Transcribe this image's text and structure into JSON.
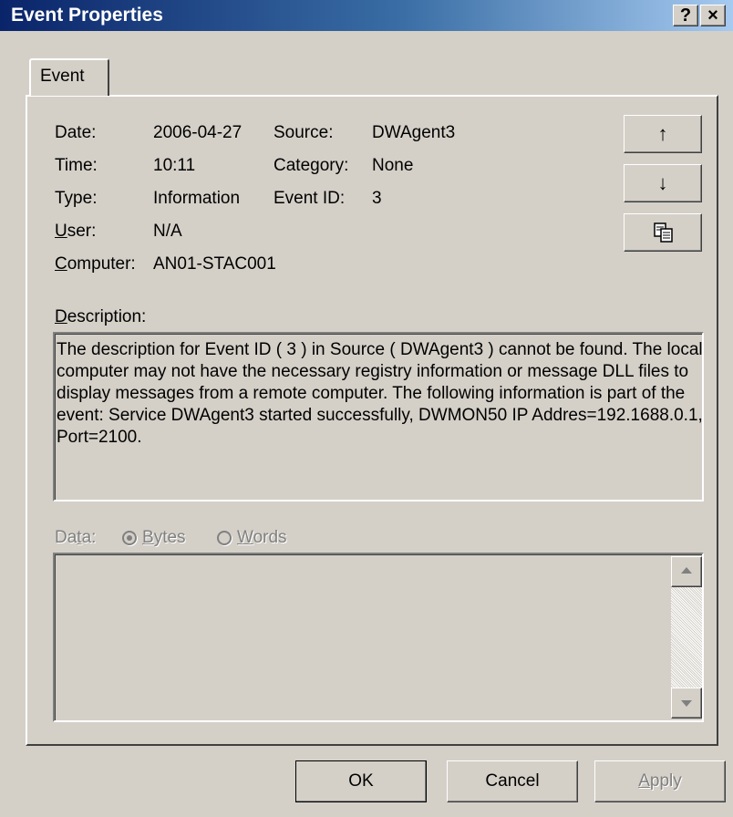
{
  "window": {
    "title": "Event Properties"
  },
  "titlebar": {
    "help_glyph": "?",
    "close_glyph": "×"
  },
  "tabs": [
    {
      "label": "Event"
    }
  ],
  "event": {
    "date_label": "Date:",
    "date_value": "2006-04-27",
    "time_label": "Time:",
    "time_value": "10:11",
    "type_label": "Type:",
    "type_value": "Information",
    "user_label": "User:",
    "user_value": "N/A",
    "computer_label": "Computer:",
    "computer_value": "AN01-STAC001",
    "source_label": "Source:",
    "source_value": "DWAgent3",
    "category_label": "Category:",
    "category_value": "None",
    "eventid_label": "Event ID:",
    "eventid_value": "3"
  },
  "nav_buttons": {
    "up_icon": "↑",
    "down_icon": "↓",
    "copy_icon": "copy-icon"
  },
  "description": {
    "label": "Description:",
    "text": "The description for Event ID ( 3 ) in Source ( DWAgent3 ) cannot be found. The local computer may not have the necessary registry information or message DLL files to display messages from a remote computer. The following information is part of the event: Service DWAgent3 started successfully, DWMON50 IP Addres=192.1688.0.1, Port=2100."
  },
  "data_section": {
    "label": "Data:",
    "options": [
      "Bytes",
      "Words"
    ],
    "selected": "Bytes"
  },
  "buttons": {
    "ok": "OK",
    "cancel": "Cancel",
    "apply": "Apply"
  },
  "colors": {
    "face": "#d4d0c8",
    "title_start": "#0a246a",
    "title_end": "#a6caf0"
  }
}
